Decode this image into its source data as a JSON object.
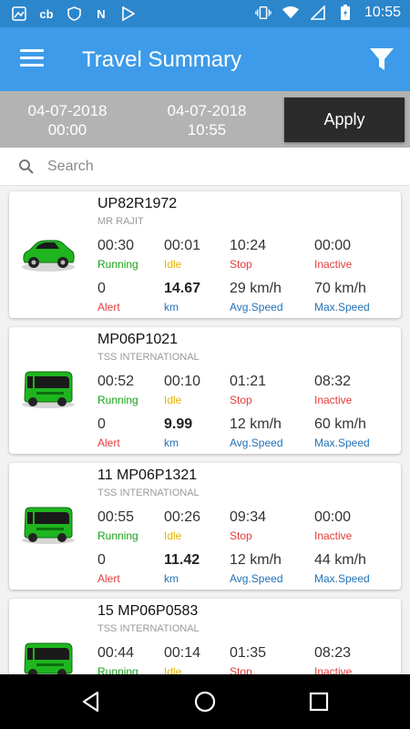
{
  "status_bar": {
    "time": "10:55",
    "left_icons": [
      "gallery-icon",
      "cb-icon",
      "shield-icon",
      "n-icon",
      "play-store-icon"
    ],
    "right_icons": [
      "vibrate-icon",
      "wifi-icon",
      "signal-icon",
      "battery-charging-icon"
    ]
  },
  "app_bar": {
    "title": "Travel Summary"
  },
  "date_range": {
    "from_date": "04-07-2018",
    "from_time": "00:00",
    "to_date": "04-07-2018",
    "to_time": "10:55",
    "apply_label": "Apply"
  },
  "search": {
    "placeholder": "Search"
  },
  "colors": {
    "status_bar": "#2b86cc",
    "app_bar": "#3d9be9",
    "running": "#17a117",
    "idle": "#e2b400",
    "stop": "#e53b3b",
    "max_speed": "#2273b7"
  },
  "vehicles": [
    {
      "icon": "car-icon",
      "number": "UP82R1972",
      "owner": "MR RAJIT",
      "running": "00:30",
      "running_label": "Running",
      "idle": "00:01",
      "idle_label": "Idle",
      "stop": "10:24",
      "stop_label": "Stop",
      "inactive": "00:00",
      "inactive_label": "Inactive",
      "alert": "0",
      "alert_label": "Alert",
      "km": "14.67",
      "km_label": "km",
      "avg_speed": "29 km/h",
      "avg_speed_label": "Avg.Speed",
      "max_speed": "70 km/h",
      "max_speed_label": "Max.Speed"
    },
    {
      "icon": "bus-icon",
      "number": "MP06P1021",
      "owner": "TSS INTERNATIONAL",
      "running": "00:52",
      "running_label": "Running",
      "idle": "00:10",
      "idle_label": "Idle",
      "stop": "01:21",
      "stop_label": "Stop",
      "inactive": "08:32",
      "inactive_label": "Inactive",
      "alert": "0",
      "alert_label": "Alert",
      "km": "9.99",
      "km_label": "km",
      "avg_speed": "12 km/h",
      "avg_speed_label": "Avg.Speed",
      "max_speed": "60 km/h",
      "max_speed_label": "Max.Speed"
    },
    {
      "icon": "bus-icon",
      "number": "11 MP06P1321",
      "owner": "TSS INTERNATIONAL",
      "running": "00:55",
      "running_label": "Running",
      "idle": "00:26",
      "idle_label": "Idle",
      "stop": "09:34",
      "stop_label": "Stop",
      "inactive": "00:00",
      "inactive_label": "Inactive",
      "alert": "0",
      "alert_label": "Alert",
      "km": "11.42",
      "km_label": "km",
      "avg_speed": "12 km/h",
      "avg_speed_label": "Avg.Speed",
      "max_speed": "44 km/h",
      "max_speed_label": "Max.Speed"
    },
    {
      "icon": "bus-icon",
      "number": "15 MP06P0583",
      "owner": "TSS INTERNATIONAL",
      "running": "00:44",
      "running_label": "Running",
      "idle": "00:14",
      "idle_label": "Idle",
      "stop": "01:35",
      "stop_label": "Stop",
      "inactive": "08:23",
      "inactive_label": "Inactive",
      "alert": "",
      "alert_label": "",
      "km": "",
      "km_label": "",
      "avg_speed": "",
      "avg_speed_label": "",
      "max_speed": "",
      "max_speed_label": ""
    }
  ],
  "nav_bar": {
    "buttons": [
      "back-icon",
      "home-icon",
      "recents-icon"
    ]
  }
}
